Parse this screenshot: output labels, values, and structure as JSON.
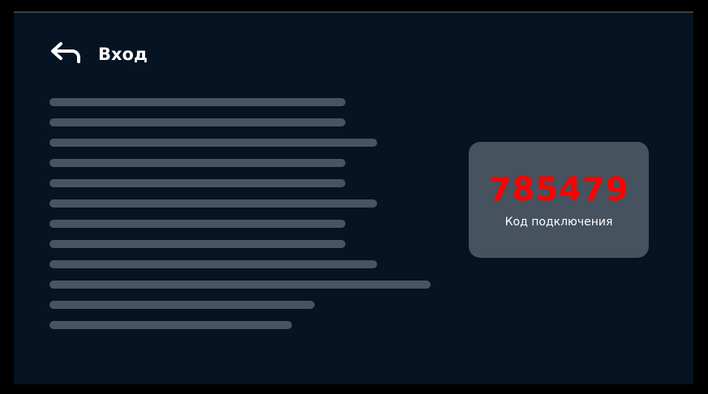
{
  "header": {
    "title": "Вход",
    "back_icon": "back-arrow-icon"
  },
  "pairing": {
    "code": "785479",
    "label": "Код подключения",
    "code_color": "#ff0000"
  },
  "colors": {
    "background": "#051322",
    "card": "#46525e",
    "placeholder_lines": "#465463"
  }
}
